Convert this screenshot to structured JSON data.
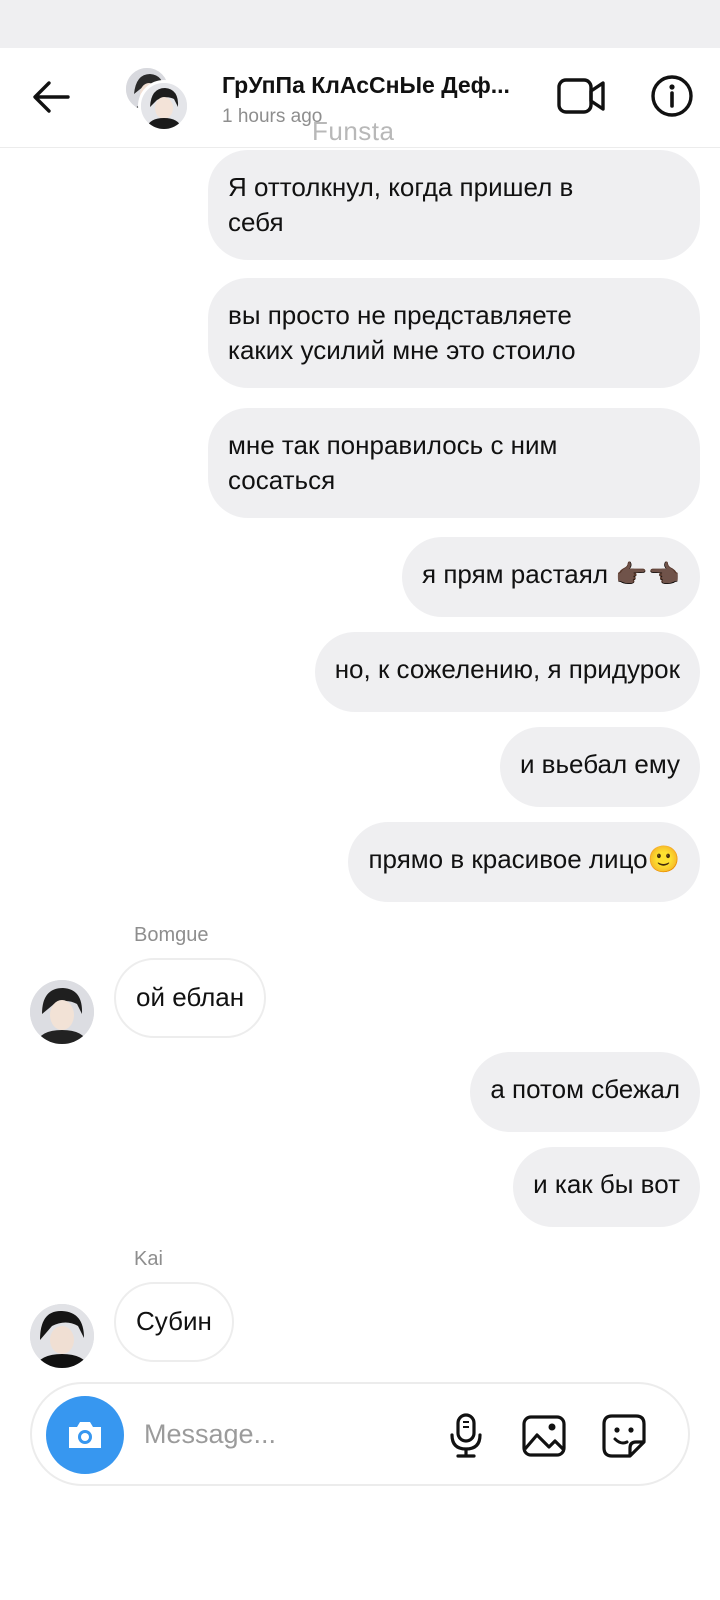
{
  "header": {
    "title": "ГрУпПа КлАсСнЫе Деф...",
    "subtitle": "1 hours ago",
    "watermark": "Funsta"
  },
  "messages": [
    {
      "from": "me",
      "text": "Я оттолкнул, когда пришел в\nсебя"
    },
    {
      "from": "me",
      "text": "вы просто не представляете\nкаких усилий мне это стоило"
    },
    {
      "from": "me",
      "text": "мне так понравилось с ним\nсосаться"
    },
    {
      "from": "me",
      "text": "я прям растаял 👉🏿👈🏿"
    },
    {
      "from": "me",
      "text": "но, к сожелению, я придурок"
    },
    {
      "from": "me",
      "text": "и вьебал ему"
    },
    {
      "from": "me",
      "text": "прямо в красивое лицо🙂"
    },
    {
      "from": "other",
      "sender": "Bomgue",
      "text": "ой еблан"
    },
    {
      "from": "me",
      "text": "а потом сбежал"
    },
    {
      "from": "me",
      "text": "и как бы вот"
    },
    {
      "from": "other",
      "sender": "Kai",
      "text": "Субин"
    }
  ],
  "composer": {
    "placeholder": "Message..."
  },
  "icons": {
    "back": "arrow-left-icon",
    "video": "video-camera-icon",
    "info": "info-icon",
    "camera": "camera-icon",
    "mic": "microphone-icon",
    "gallery": "image-icon",
    "sticker": "sticker-icon"
  },
  "colors": {
    "accent": "#3797f0",
    "bubble": "#efeff1",
    "muted": "#8e8e8e"
  }
}
